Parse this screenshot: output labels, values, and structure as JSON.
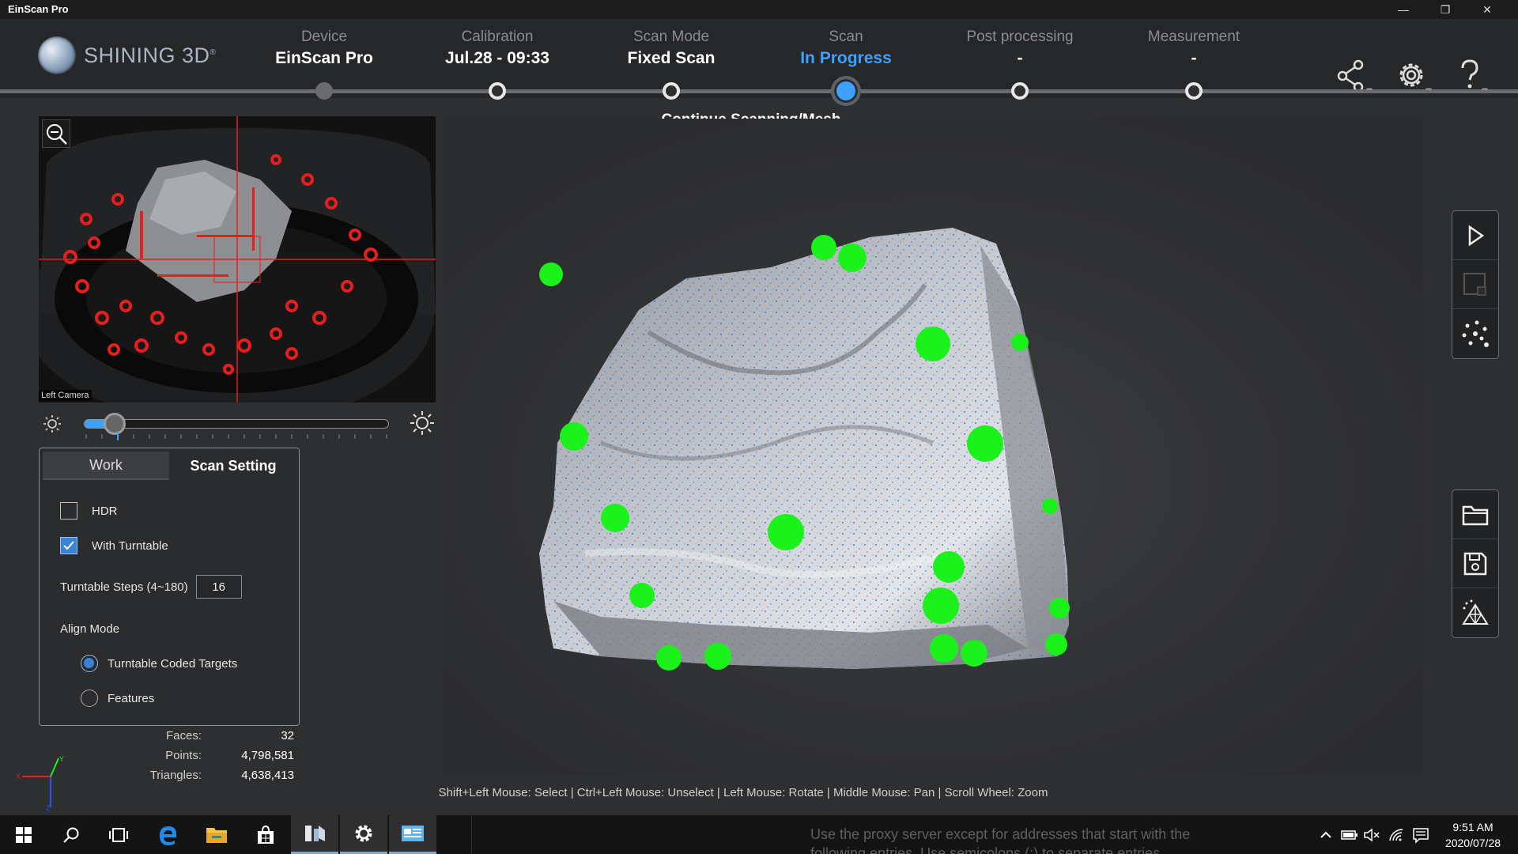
{
  "window": {
    "title": "EinScan Pro",
    "minimize": "—",
    "maximize": "❐",
    "close": "✕"
  },
  "brand": {
    "name": "SHINING 3D",
    "reg": "®"
  },
  "steps": [
    {
      "label": "Device",
      "value": "EinScan Pro"
    },
    {
      "label": "Calibration",
      "value": "Jul.28 - 09:33"
    },
    {
      "label": "Scan Mode",
      "value": "Fixed Scan"
    },
    {
      "label": "Scan",
      "value": "In Progress"
    },
    {
      "label": "Post processing",
      "value": "-"
    },
    {
      "label": "Measurement",
      "value": "-"
    }
  ],
  "current_step_hint": "Continue Scanning/Mesh",
  "camera": {
    "label": "Left Camera"
  },
  "brightness": {
    "level": 0.1
  },
  "tabs": {
    "work": "Work",
    "scan_setting": "Scan Setting"
  },
  "settings": {
    "hdr": {
      "label": "HDR",
      "checked": false
    },
    "turntable": {
      "label": "With Turntable",
      "checked": true
    },
    "turntable_steps": {
      "label": "Turntable Steps (4~180)",
      "value": "16"
    },
    "align_mode": {
      "label": "Align Mode",
      "options": [
        {
          "label": "Turntable Coded Targets",
          "selected": true
        },
        {
          "label": "Features",
          "selected": false
        }
      ]
    }
  },
  "stats": {
    "faces": {
      "label": "Faces:",
      "value": "32"
    },
    "points": {
      "label": "Points:",
      "value": "4,798,581"
    },
    "triangles": {
      "label": "Triangles:",
      "value": "4,638,413"
    }
  },
  "axis": {
    "x": "X",
    "y": "Y",
    "z": "Z"
  },
  "mouse_hints": "Shift+Left Mouse: Select | Ctrl+Left Mouse: Unselect | Left Mouse: Rotate | Middle Mouse: Pan | Scroll Wheel: Zoom",
  "taskbar": {
    "background_text_1": "Use the proxy server except for addresses that start with the",
    "background_text_2": "following entries. Use semicolons (;) to separate entries.",
    "time": "9:51 AM",
    "date": "2020/07/28"
  },
  "colors": {
    "accent": "#3ea0ff",
    "target_green": "#1bf21b",
    "target_red": "#e61e1e"
  }
}
